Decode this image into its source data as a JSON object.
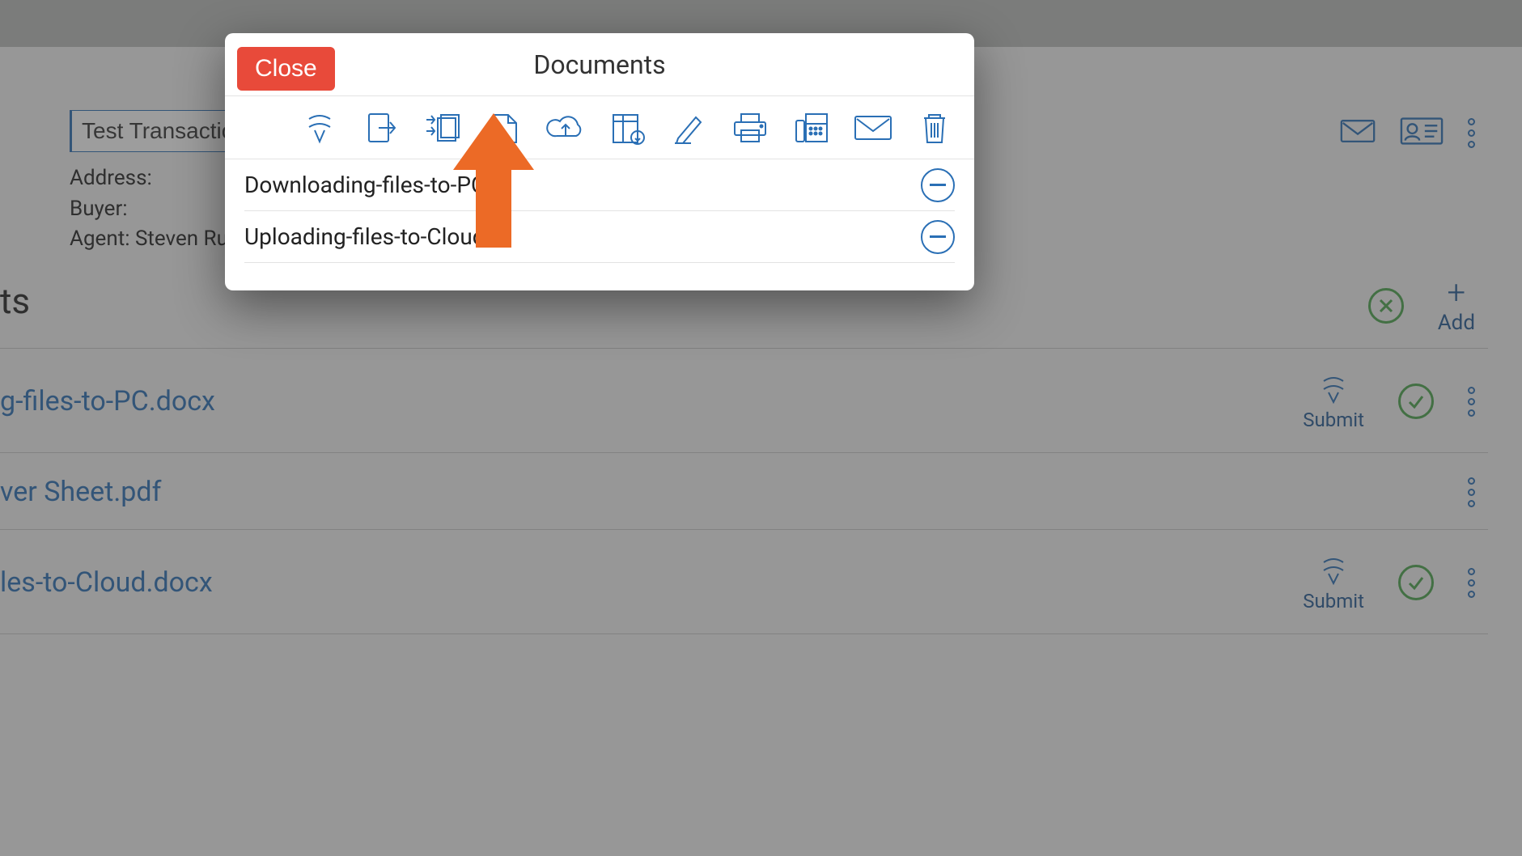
{
  "background": {
    "transaction_input_value": "Test Transaction",
    "meta": {
      "address_label": "Address:",
      "buyer_label": "Buyer:",
      "agent_label": "Agent: Steven Rus"
    },
    "section_title_fragment": "ts",
    "add_label": "Add",
    "submit_label": "Submit",
    "docs": [
      {
        "name": "g-files-to-PC.docx",
        "has_submit": true,
        "has_check": true,
        "has_kebab": true
      },
      {
        "name": "ver Sheet.pdf",
        "has_submit": false,
        "has_check": false,
        "has_kebab": true
      },
      {
        "name": "les-to-Cloud.docx",
        "has_submit": true,
        "has_check": true,
        "has_kebab": true
      }
    ]
  },
  "modal": {
    "close_label": "Close",
    "title": "Documents",
    "toolbar_icons": [
      "submit-icon",
      "export-icon",
      "merge-icon",
      "new-doc-icon",
      "cloud-upload-icon",
      "archive-download-icon",
      "sign-icon",
      "print-icon",
      "fax-icon",
      "mail-icon",
      "trash-icon"
    ],
    "items": [
      {
        "name": "Downloading-files-to-PC"
      },
      {
        "name": "Uploading-files-to-Cloud"
      }
    ]
  }
}
